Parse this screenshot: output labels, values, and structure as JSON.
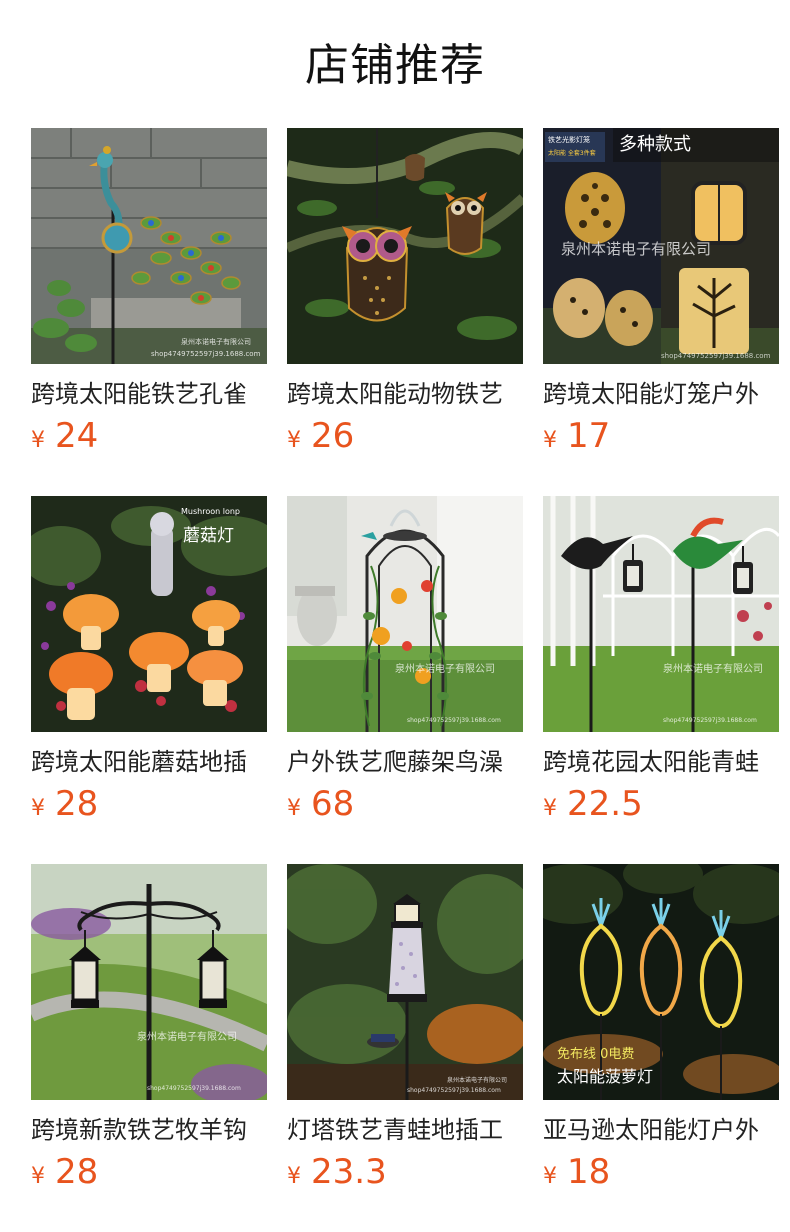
{
  "page": {
    "title": "店铺推荐"
  },
  "currency_symbol": "¥",
  "products": [
    {
      "name": "跨境太阳能铁艺孔雀",
      "price": "24",
      "image_alt": "peacock-solar-stake",
      "image_text": "泉州本诺电子有限公司 shop4749752597j39.1688.com"
    },
    {
      "name": "跨境太阳能动物铁艺",
      "price": "26",
      "image_alt": "owl-solar-lantern",
      "image_text": ""
    },
    {
      "name": "跨境太阳能灯笼户外",
      "price": "17",
      "image_alt": "moroccan-solar-lanterns",
      "image_text": "多种款式 泉州本诺电子有限公司 铁艺光影灯笼 太阳能 全套3件套"
    },
    {
      "name": "跨境太阳能蘑菇地插",
      "price": "28",
      "image_alt": "mushroom-solar-lamps",
      "image_text": "Mushroon lonp 蘑菇灯"
    },
    {
      "name": "户外铁艺爬藤架鸟澡",
      "price": "68",
      "image_alt": "trellis-bird-bath",
      "image_text": "泉州本诺电子有限公司"
    },
    {
      "name": "跨境花园太阳能青蛙",
      "price": "22.5",
      "image_alt": "hummingbird-solar-stakes",
      "image_text": "泉州本诺电子有限公司"
    },
    {
      "name": "跨境新款铁艺牧羊钩",
      "price": "28",
      "image_alt": "shepherd-hook-lanterns",
      "image_text": "泉州本诺电子有限公司"
    },
    {
      "name": "灯塔铁艺青蛙地插工",
      "price": "23.3",
      "image_alt": "lighthouse-solar-stake",
      "image_text": "泉州本诺电子有限公司"
    },
    {
      "name": "亚马逊太阳能灯户外",
      "price": "18",
      "image_alt": "pineapple-neon-solar-lights",
      "image_text": "免布线 0电费 太阳能菠萝灯"
    }
  ],
  "colors": {
    "price": "#e8541e",
    "title": "#111111",
    "text": "#222222"
  }
}
